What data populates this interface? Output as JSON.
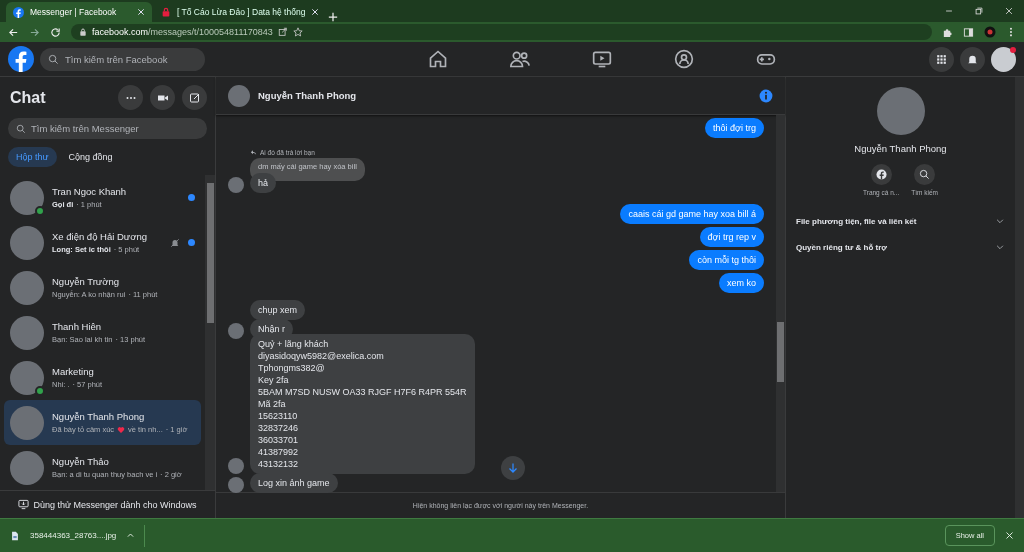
{
  "browser": {
    "tabs": [
      {
        "title": "Messenger | Facebook",
        "selected": true
      },
      {
        "title": "[ Tố Cáo Lừa Đảo ] Data hệ thống",
        "selected": false
      }
    ],
    "url_host": "facebook.com",
    "url_path": "/messages/t/100054811170843"
  },
  "header": {
    "search_placeholder": "Tìm kiếm trên Facebook"
  },
  "sidebar": {
    "title": "Chat",
    "search_placeholder": "Tìm kiếm trên Messenger",
    "filters": [
      {
        "label": "Hộp thư",
        "selected": true
      },
      {
        "label": "Cộng đồng",
        "selected": false
      }
    ],
    "conversations": [
      {
        "name": "Tran Ngoc Khanh",
        "preview": "Gọi đi",
        "time": "· 1 phút",
        "online": true,
        "unread": true,
        "muted": false,
        "selected": false
      },
      {
        "name": "Xe điện độ Hải Dương",
        "preview": "Long: Set ic thôi",
        "time": "· 5 phút",
        "online": false,
        "unread": true,
        "muted": true,
        "selected": false
      },
      {
        "name": "Nguyễn Trường",
        "preview": "Nguyễn: A ko nhận rui",
        "time": "· 11 phút",
        "online": false,
        "unread": false,
        "muted": false,
        "selected": false
      },
      {
        "name": "Thanh Hiên",
        "preview": "Bạn: Sao lai kh tin",
        "time": "· 13 phút",
        "online": false,
        "unread": false,
        "muted": false,
        "selected": false
      },
      {
        "name": "Marketing",
        "preview": "Nhi: .",
        "time": "· 57 phút",
        "online": true,
        "unread": false,
        "muted": false,
        "selected": false
      },
      {
        "name": "Nguyễn Thanh Phong",
        "preview": "Đã bày tỏ cảm xúc",
        "preview_after": "về tin nh...",
        "time": "· 1 giờ",
        "online": false,
        "unread": false,
        "muted": false,
        "selected": true
      },
      {
        "name": "Nguyễn Thảo",
        "preview": "Bạn: a di tu quan thuy bach ve i",
        "time": "· 2 giờ",
        "online": false,
        "unread": false,
        "muted": false,
        "selected": false
      }
    ],
    "footer": "Dùng thử Messenger dành cho Windows"
  },
  "chat": {
    "name": "Nguyễn Thanh Phong",
    "messages": [
      {
        "kind": "out",
        "text": "thôi đợi trg"
      },
      {
        "kind": "in",
        "reply_note": "Ai đó đã trả lời bạn",
        "quoted": "dm mấy cái game hay xóa bill",
        "text": "hả",
        "avatar": true
      },
      {
        "kind": "out",
        "text": "caais cái gd game hay xoa bill á"
      },
      {
        "kind": "out",
        "text": "đợi trg rep v"
      },
      {
        "kind": "out",
        "text": "còn mỗi tg thôi"
      },
      {
        "kind": "out",
        "text": "xem ko"
      },
      {
        "kind": "in",
        "text": "chụp xem",
        "avatar": false
      },
      {
        "kind": "in",
        "text": "Nhận r",
        "avatar": true
      },
      {
        "kind": "in",
        "text": "Quỷ + lãng khách\ndiyasidoqyw5982@exelica.com\nTphongms382@\nKey 2fa\n5BAM M7SD NUSW OA33 RJGF H7F6 R4PR 554R\nMã 2fa\n15623110\n32837246\n36033701\n41387992\n43132132",
        "avatar": true
      },
      {
        "kind": "in",
        "text": "Log xin ảnh game",
        "avatar": true
      }
    ],
    "notice": "Hiện không liên lạc được với người này trên Messenger."
  },
  "profile": {
    "name": "Nguyễn Thanh Phong",
    "actions": [
      {
        "kind": "facebook",
        "label": "Trang cá n..."
      },
      {
        "kind": "search",
        "label": "Tìm kiếm"
      }
    ],
    "sections": [
      "File phương tiện, file và liên kết",
      "Quyền riêng tư & hỗ trợ"
    ]
  },
  "downloads": {
    "file": "358444363_28763....jpg",
    "show_all": "Show all"
  }
}
